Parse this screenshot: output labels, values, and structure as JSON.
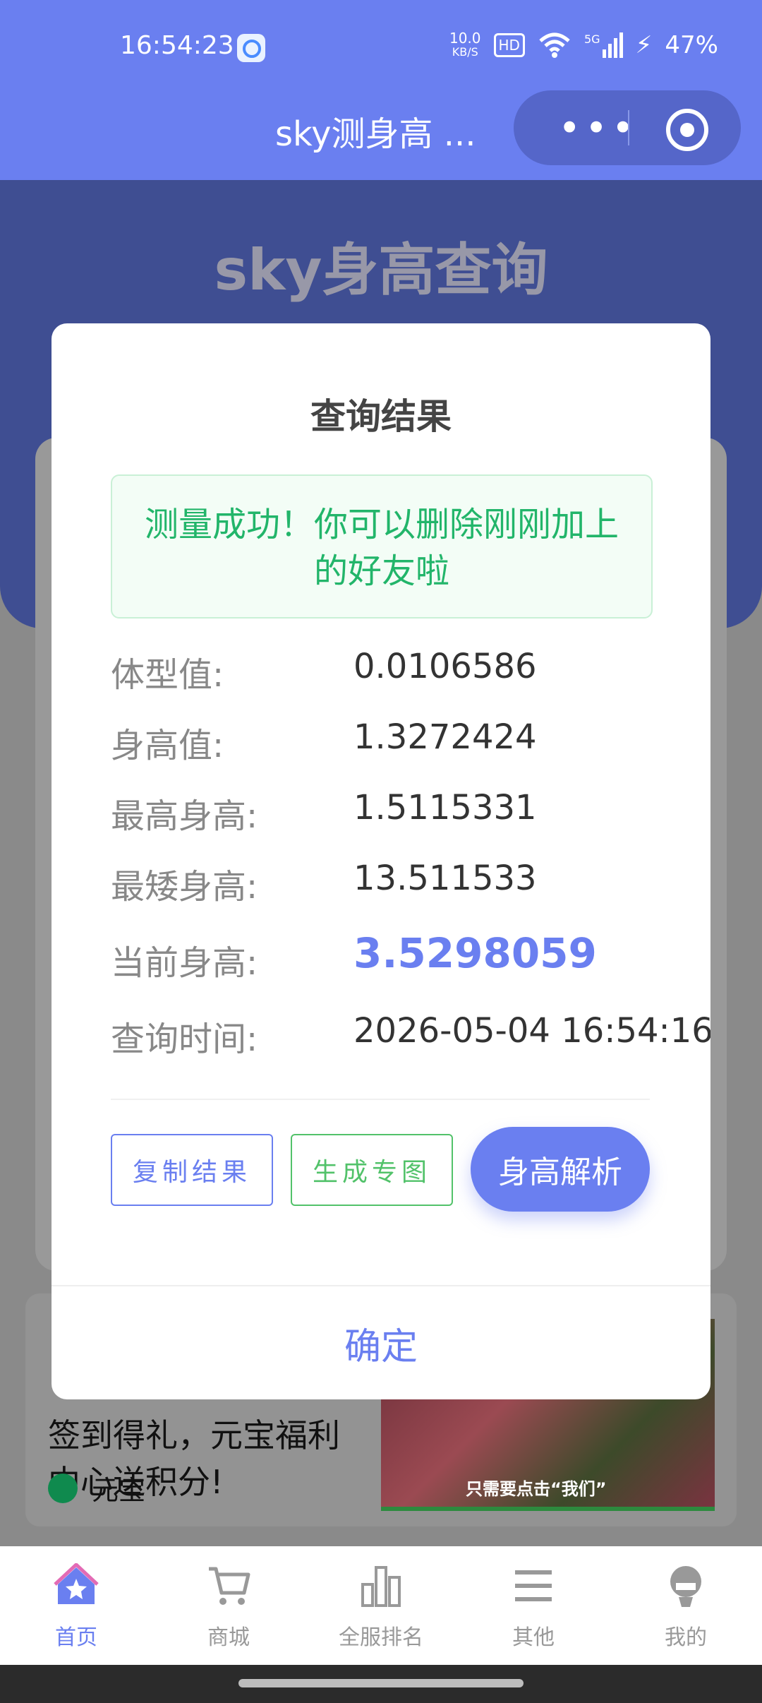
{
  "status_bar": {
    "time": "16:54:23",
    "net_speed_value": "10.0",
    "net_speed_unit": "KB/S",
    "hd_badge": "HD",
    "signal_label": "5G",
    "battery": "47%"
  },
  "titlebar": {
    "title": "sky测身高 ...",
    "more_icon": "•••"
  },
  "background": {
    "hero_title": "sky身高查询",
    "ad_text": "签到得礼，元宝福利中心送积分!",
    "ad_brand": "元宝",
    "ad_image_caption": "只需要点击“我们”"
  },
  "modal": {
    "title": "查询结果",
    "success_message": "测量成功！你可以删除刚刚加上的好友啦",
    "rows": [
      {
        "label": "体型值:",
        "value": "0.0106586"
      },
      {
        "label": "身高值:",
        "value": "1.3272424"
      },
      {
        "label": "最高身高:",
        "value": "1.5115331"
      },
      {
        "label": "最矮身高:",
        "value": "13.511533"
      },
      {
        "label": "当前身高:",
        "value": "3.5298059"
      },
      {
        "label": "查询时间:",
        "value": "2026-05-04 16:54:16"
      }
    ],
    "copy_button": "复制结果",
    "generate_button": "生成专图",
    "analyze_button": "身高解析",
    "confirm_button": "确定"
  },
  "tabbar": {
    "items": [
      {
        "label": "首页",
        "icon": "home-star-icon",
        "active": true
      },
      {
        "label": "商城",
        "icon": "cart-icon",
        "active": false
      },
      {
        "label": "全服排名",
        "icon": "bar-chart-icon",
        "active": false
      },
      {
        "label": "其他",
        "icon": "menu-icon",
        "active": false
      },
      {
        "label": "我的",
        "icon": "user-icon",
        "active": false
      }
    ]
  },
  "colors": {
    "accent": "#6a7ff0",
    "success": "#22b56a"
  }
}
